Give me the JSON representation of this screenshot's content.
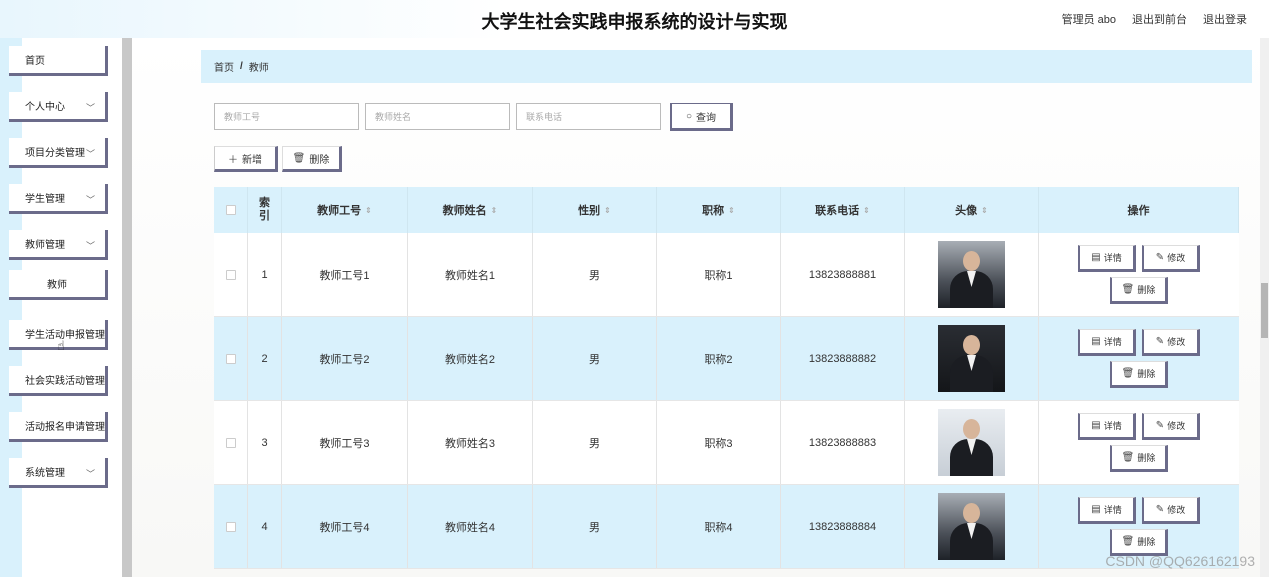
{
  "header": {
    "title": "大学生社会实践申报系统的设计与实现",
    "admin_label": "管理员 abo",
    "back_front": "退出到前台",
    "logout": "退出登录"
  },
  "sidebar": {
    "items": [
      {
        "label": "首页",
        "has_chevron": false
      },
      {
        "label": "个人中心",
        "has_chevron": true
      },
      {
        "label": "项目分类管理",
        "has_chevron": true
      },
      {
        "label": "学生管理",
        "has_chevron": true
      },
      {
        "label": "教师管理",
        "has_chevron": true
      },
      {
        "label": "教师",
        "has_chevron": false
      },
      {
        "label": "学生活动申报管理",
        "has_chevron": false
      },
      {
        "label": "社会实践活动管理",
        "has_chevron": false
      },
      {
        "label": "活动报名申请管理",
        "has_chevron": false
      },
      {
        "label": "系统管理",
        "has_chevron": true
      }
    ]
  },
  "breadcrumb": {
    "home": "首页",
    "separator": "/",
    "current": "教师"
  },
  "search": {
    "teacher_id_placeholder": "教师工号",
    "teacher_name_placeholder": "教师姓名",
    "phone_placeholder": "联系电话",
    "query_label": "查询"
  },
  "actions": {
    "add_label": "新增",
    "delete_label": "删除"
  },
  "table": {
    "headers": [
      "索引",
      "教师工号",
      "教师姓名",
      "性别",
      "职称",
      "联系电话",
      "头像",
      "操作"
    ],
    "rows": [
      {
        "index": "1",
        "teacher_id": "教师工号1",
        "name": "教师姓名1",
        "gender": "男",
        "title": "职称1",
        "phone": "13823888881"
      },
      {
        "index": "2",
        "teacher_id": "教师工号2",
        "name": "教师姓名2",
        "gender": "男",
        "title": "职称2",
        "phone": "13823888882"
      },
      {
        "index": "3",
        "teacher_id": "教师工号3",
        "name": "教师姓名3",
        "gender": "男",
        "title": "职称3",
        "phone": "13823888883"
      },
      {
        "index": "4",
        "teacher_id": "教师工号4",
        "name": "教师姓名4",
        "gender": "男",
        "title": "职称4",
        "phone": "13823888884"
      }
    ],
    "row_actions": {
      "detail": "详情",
      "edit": "修改",
      "remove": "删除"
    }
  },
  "watermark": "CSDN @QQ626162193",
  "colors": {
    "accent": "#d9f1fc",
    "button_shadow": "#6b6b8a"
  }
}
